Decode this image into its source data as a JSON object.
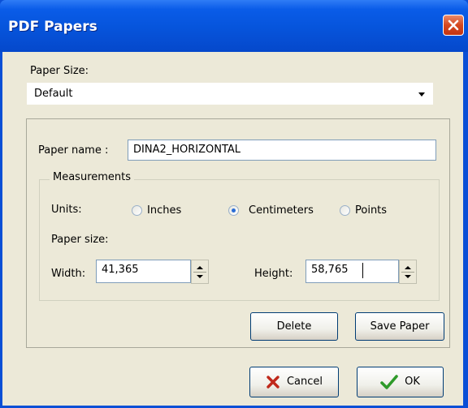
{
  "window": {
    "title": "PDF Papers"
  },
  "paper_size": {
    "label": "Paper Size:",
    "selected": "Default"
  },
  "paper_name": {
    "label": "Paper name :",
    "value": "DINA2_HORIZONTAL"
  },
  "measurements": {
    "title": "Measurements",
    "units_label": "Units:",
    "units": [
      {
        "label": "Inches",
        "selected": false
      },
      {
        "label": "Centimeters",
        "selected": true
      },
      {
        "label": "Points",
        "selected": false
      }
    ],
    "paper_size_label": "Paper size:",
    "width_label": "Width:",
    "width_value": "41,365",
    "height_label": "Height:",
    "height_value": "58,765"
  },
  "buttons": {
    "delete": "Delete",
    "save_paper": "Save Paper",
    "cancel": "Cancel",
    "ok": "OK"
  },
  "colors": {
    "titlebar": "#0a5ce8",
    "dialog_bg": "#ece9d8",
    "accent_radio": "#2a6dd6"
  }
}
